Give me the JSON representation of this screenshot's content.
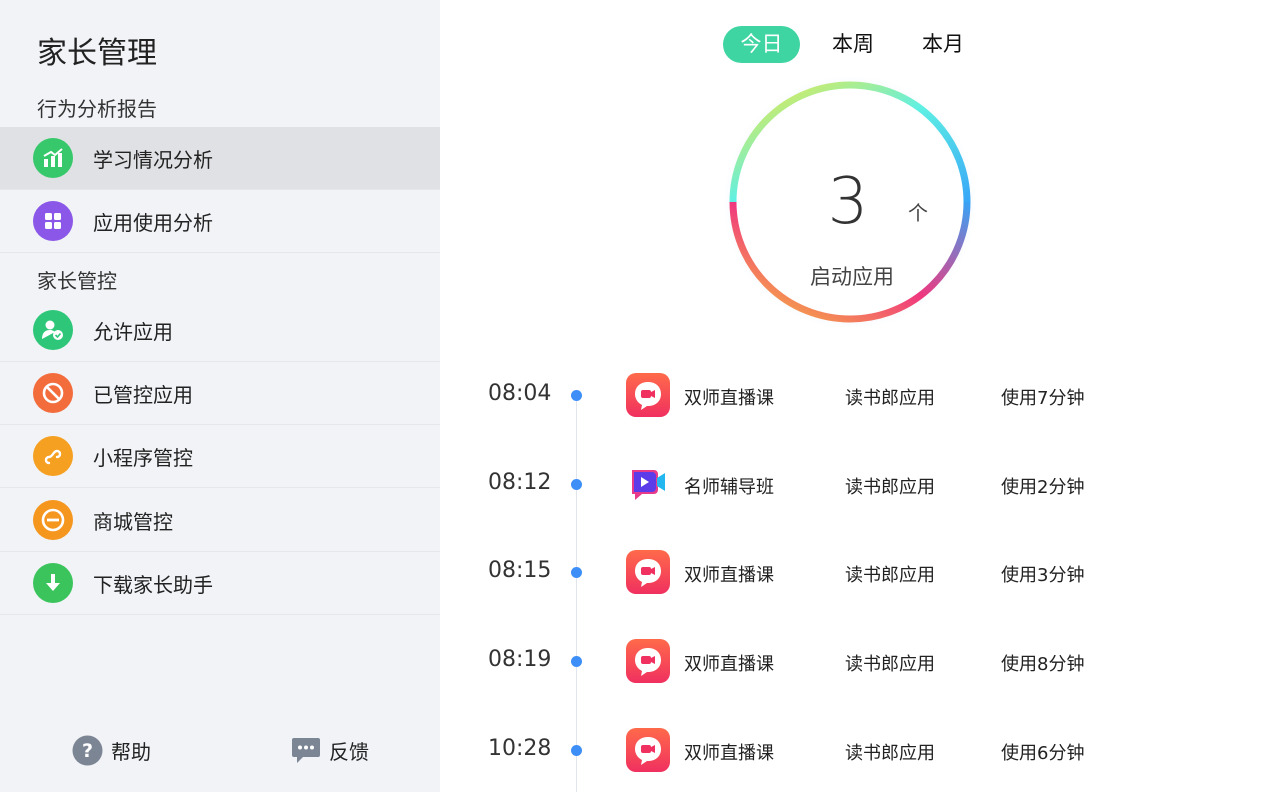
{
  "sidebar": {
    "title": "家长管理",
    "section_report": "行为分析报告",
    "section_control": "家长管控",
    "items": [
      {
        "label": "学习情况分析",
        "icon": "chart-icon",
        "color": "#36c86a"
      },
      {
        "label": "应用使用分析",
        "icon": "grid-icon",
        "color": "#8a57e8"
      },
      {
        "label": "允许应用",
        "icon": "user-check-icon",
        "color": "#2ec779"
      },
      {
        "label": "已管控应用",
        "icon": "block-icon",
        "color": "#f26c3c"
      },
      {
        "label": "小程序管控",
        "icon": "mini-program-icon",
        "color": "#f5a021"
      },
      {
        "label": "商城管控",
        "icon": "minus-circle-icon",
        "color": "#f5961f"
      },
      {
        "label": "下载家长助手",
        "icon": "download-icon",
        "color": "#3bc45c"
      }
    ],
    "footer": {
      "help": "帮助",
      "feedback": "反馈"
    }
  },
  "tabs": [
    "今日",
    "本周",
    "本月"
  ],
  "summary": {
    "count": "3",
    "unit": "个",
    "label": "启动应用"
  },
  "timeline": [
    {
      "time": "08:04",
      "app": "双师直播课",
      "source": "读书郎应用",
      "usage": "使用7分钟",
      "icon": "live-class-icon"
    },
    {
      "time": "08:12",
      "app": "名师辅导班",
      "source": "读书郎应用",
      "usage": "使用2分钟",
      "icon": "video-tutor-icon"
    },
    {
      "time": "08:15",
      "app": "双师直播课",
      "source": "读书郎应用",
      "usage": "使用3分钟",
      "icon": "live-class-icon"
    },
    {
      "time": "08:19",
      "app": "双师直播课",
      "source": "读书郎应用",
      "usage": "使用8分钟",
      "icon": "live-class-icon"
    },
    {
      "time": "10:28",
      "app": "双师直播课",
      "source": "读书郎应用",
      "usage": "使用6分钟",
      "icon": "live-class-icon"
    }
  ],
  "colors": {
    "accent": "#3fd5a3",
    "dot": "#3d8ef7",
    "sidebar_bg": "#f1f3f7",
    "active_bg": "#dfe1e4"
  }
}
